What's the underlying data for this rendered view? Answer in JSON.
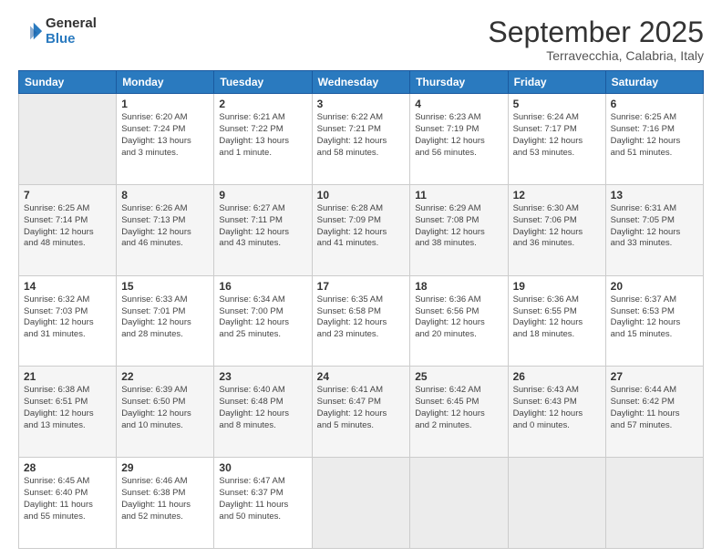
{
  "header": {
    "logo_line1": "General",
    "logo_line2": "Blue",
    "month": "September 2025",
    "location": "Terravecchia, Calabria, Italy"
  },
  "weekdays": [
    "Sunday",
    "Monday",
    "Tuesday",
    "Wednesday",
    "Thursday",
    "Friday",
    "Saturday"
  ],
  "weeks": [
    [
      {
        "day": "",
        "info": ""
      },
      {
        "day": "1",
        "info": "Sunrise: 6:20 AM\nSunset: 7:24 PM\nDaylight: 13 hours\nand 3 minutes."
      },
      {
        "day": "2",
        "info": "Sunrise: 6:21 AM\nSunset: 7:22 PM\nDaylight: 13 hours\nand 1 minute."
      },
      {
        "day": "3",
        "info": "Sunrise: 6:22 AM\nSunset: 7:21 PM\nDaylight: 12 hours\nand 58 minutes."
      },
      {
        "day": "4",
        "info": "Sunrise: 6:23 AM\nSunset: 7:19 PM\nDaylight: 12 hours\nand 56 minutes."
      },
      {
        "day": "5",
        "info": "Sunrise: 6:24 AM\nSunset: 7:17 PM\nDaylight: 12 hours\nand 53 minutes."
      },
      {
        "day": "6",
        "info": "Sunrise: 6:25 AM\nSunset: 7:16 PM\nDaylight: 12 hours\nand 51 minutes."
      }
    ],
    [
      {
        "day": "7",
        "info": "Sunrise: 6:25 AM\nSunset: 7:14 PM\nDaylight: 12 hours\nand 48 minutes."
      },
      {
        "day": "8",
        "info": "Sunrise: 6:26 AM\nSunset: 7:13 PM\nDaylight: 12 hours\nand 46 minutes."
      },
      {
        "day": "9",
        "info": "Sunrise: 6:27 AM\nSunset: 7:11 PM\nDaylight: 12 hours\nand 43 minutes."
      },
      {
        "day": "10",
        "info": "Sunrise: 6:28 AM\nSunset: 7:09 PM\nDaylight: 12 hours\nand 41 minutes."
      },
      {
        "day": "11",
        "info": "Sunrise: 6:29 AM\nSunset: 7:08 PM\nDaylight: 12 hours\nand 38 minutes."
      },
      {
        "day": "12",
        "info": "Sunrise: 6:30 AM\nSunset: 7:06 PM\nDaylight: 12 hours\nand 36 minutes."
      },
      {
        "day": "13",
        "info": "Sunrise: 6:31 AM\nSunset: 7:05 PM\nDaylight: 12 hours\nand 33 minutes."
      }
    ],
    [
      {
        "day": "14",
        "info": "Sunrise: 6:32 AM\nSunset: 7:03 PM\nDaylight: 12 hours\nand 31 minutes."
      },
      {
        "day": "15",
        "info": "Sunrise: 6:33 AM\nSunset: 7:01 PM\nDaylight: 12 hours\nand 28 minutes."
      },
      {
        "day": "16",
        "info": "Sunrise: 6:34 AM\nSunset: 7:00 PM\nDaylight: 12 hours\nand 25 minutes."
      },
      {
        "day": "17",
        "info": "Sunrise: 6:35 AM\nSunset: 6:58 PM\nDaylight: 12 hours\nand 23 minutes."
      },
      {
        "day": "18",
        "info": "Sunrise: 6:36 AM\nSunset: 6:56 PM\nDaylight: 12 hours\nand 20 minutes."
      },
      {
        "day": "19",
        "info": "Sunrise: 6:36 AM\nSunset: 6:55 PM\nDaylight: 12 hours\nand 18 minutes."
      },
      {
        "day": "20",
        "info": "Sunrise: 6:37 AM\nSunset: 6:53 PM\nDaylight: 12 hours\nand 15 minutes."
      }
    ],
    [
      {
        "day": "21",
        "info": "Sunrise: 6:38 AM\nSunset: 6:51 PM\nDaylight: 12 hours\nand 13 minutes."
      },
      {
        "day": "22",
        "info": "Sunrise: 6:39 AM\nSunset: 6:50 PM\nDaylight: 12 hours\nand 10 minutes."
      },
      {
        "day": "23",
        "info": "Sunrise: 6:40 AM\nSunset: 6:48 PM\nDaylight: 12 hours\nand 8 minutes."
      },
      {
        "day": "24",
        "info": "Sunrise: 6:41 AM\nSunset: 6:47 PM\nDaylight: 12 hours\nand 5 minutes."
      },
      {
        "day": "25",
        "info": "Sunrise: 6:42 AM\nSunset: 6:45 PM\nDaylight: 12 hours\nand 2 minutes."
      },
      {
        "day": "26",
        "info": "Sunrise: 6:43 AM\nSunset: 6:43 PM\nDaylight: 12 hours\nand 0 minutes."
      },
      {
        "day": "27",
        "info": "Sunrise: 6:44 AM\nSunset: 6:42 PM\nDaylight: 11 hours\nand 57 minutes."
      }
    ],
    [
      {
        "day": "28",
        "info": "Sunrise: 6:45 AM\nSunset: 6:40 PM\nDaylight: 11 hours\nand 55 minutes."
      },
      {
        "day": "29",
        "info": "Sunrise: 6:46 AM\nSunset: 6:38 PM\nDaylight: 11 hours\nand 52 minutes."
      },
      {
        "day": "30",
        "info": "Sunrise: 6:47 AM\nSunset: 6:37 PM\nDaylight: 11 hours\nand 50 minutes."
      },
      {
        "day": "",
        "info": ""
      },
      {
        "day": "",
        "info": ""
      },
      {
        "day": "",
        "info": ""
      },
      {
        "day": "",
        "info": ""
      }
    ]
  ]
}
